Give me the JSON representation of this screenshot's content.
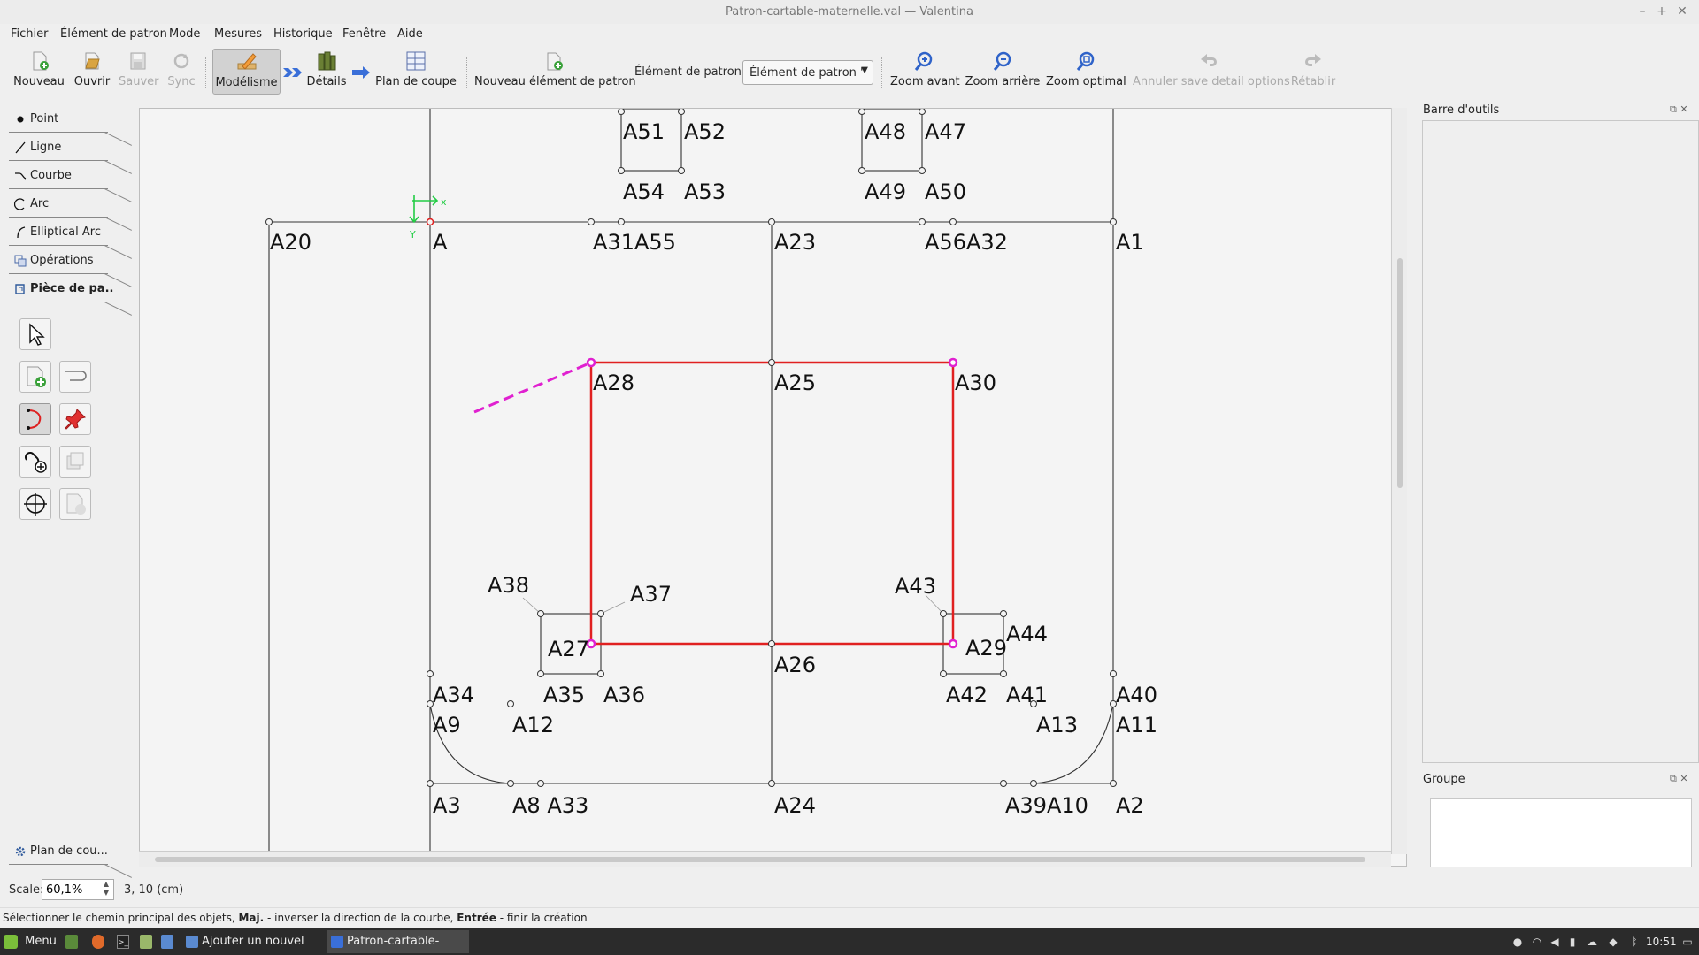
{
  "window": {
    "title": "Patron-cartable-maternelle.val — Valentina",
    "controls": [
      "–",
      "+",
      "✕"
    ]
  },
  "menu": [
    "Fichier",
    "Élément de patron",
    "Mode",
    "Mesures",
    "Historique",
    "Fenêtre",
    "Aide"
  ],
  "toolbar": {
    "nouveau": "Nouveau",
    "ouvrir": "Ouvrir",
    "sauver": "Sauver",
    "sync": "Sync",
    "modelisme": "Modélisme",
    "details": "Détails",
    "plan_de_coupe": "Plan de coupe",
    "nouvel_element": "Nouveau élément de patron",
    "element_label": "Élément de patron :",
    "element_value": "Élément de patron '",
    "zoom_avant": "Zoom avant",
    "zoom_arriere": "Zoom arrière",
    "zoom_optimal": "Zoom optimal",
    "annuler": "Annuler save detail options",
    "retablir": "Rétablir"
  },
  "tool_tabs": [
    "Point",
    "Ligne",
    "Courbe",
    "Arc",
    "Elliptical Arc",
    "Opérations",
    "Pièce de pa.."
  ],
  "bottom_tab": "Plan de cou...",
  "canvas": {
    "axis_x": "x",
    "axis_y": "Y",
    "labels": {
      "A51": "A51",
      "A52": "A52",
      "A48": "A48",
      "A47": "A47",
      "A54": "A54",
      "A53": "A53",
      "A49": "A49",
      "A50": "A50",
      "A20": "A20",
      "A": "A",
      "A31A55": "A31A55",
      "A23": "A23",
      "A56A32": "A56A32",
      "A1": "A1",
      "A28": "A28",
      "A25": "A25",
      "A30": "A30",
      "A38": "A38",
      "A37": "A37",
      "A43": "A43",
      "A44": "A44",
      "A27": "A27",
      "A29": "A29",
      "A26": "A26",
      "A35": "A35",
      "A36": "A36",
      "A42": "A42",
      "A41": "A41",
      "A34": "A34",
      "A40": "A40",
      "A9": "A9",
      "A12": "A12",
      "A13": "A13",
      "A11": "A11",
      "A3": "A3",
      "A8A33": "A8 A33",
      "A24": "A24",
      "A39A10": "A39A10",
      "A2": "A2"
    }
  },
  "dock": {
    "tools_title": "Barre d'outils",
    "group_title": "Groupe"
  },
  "status": {
    "scale_label": "Scale:",
    "scale_value": "60,1%",
    "coords": "3, 10 (cm)",
    "msg_1": "Sélectionner le chemin principal des objets, ",
    "msg_maj": "Maj.",
    "msg_2": " - inverser la direction de la courbe, ",
    "msg_entree": "Entrée",
    "msg_3": " - finir la création"
  },
  "taskbar": {
    "menu": "Menu",
    "task1": "Ajouter un nouvel ar...",
    "task2": "Patron-cartable-mat...",
    "clock": "10:51"
  }
}
